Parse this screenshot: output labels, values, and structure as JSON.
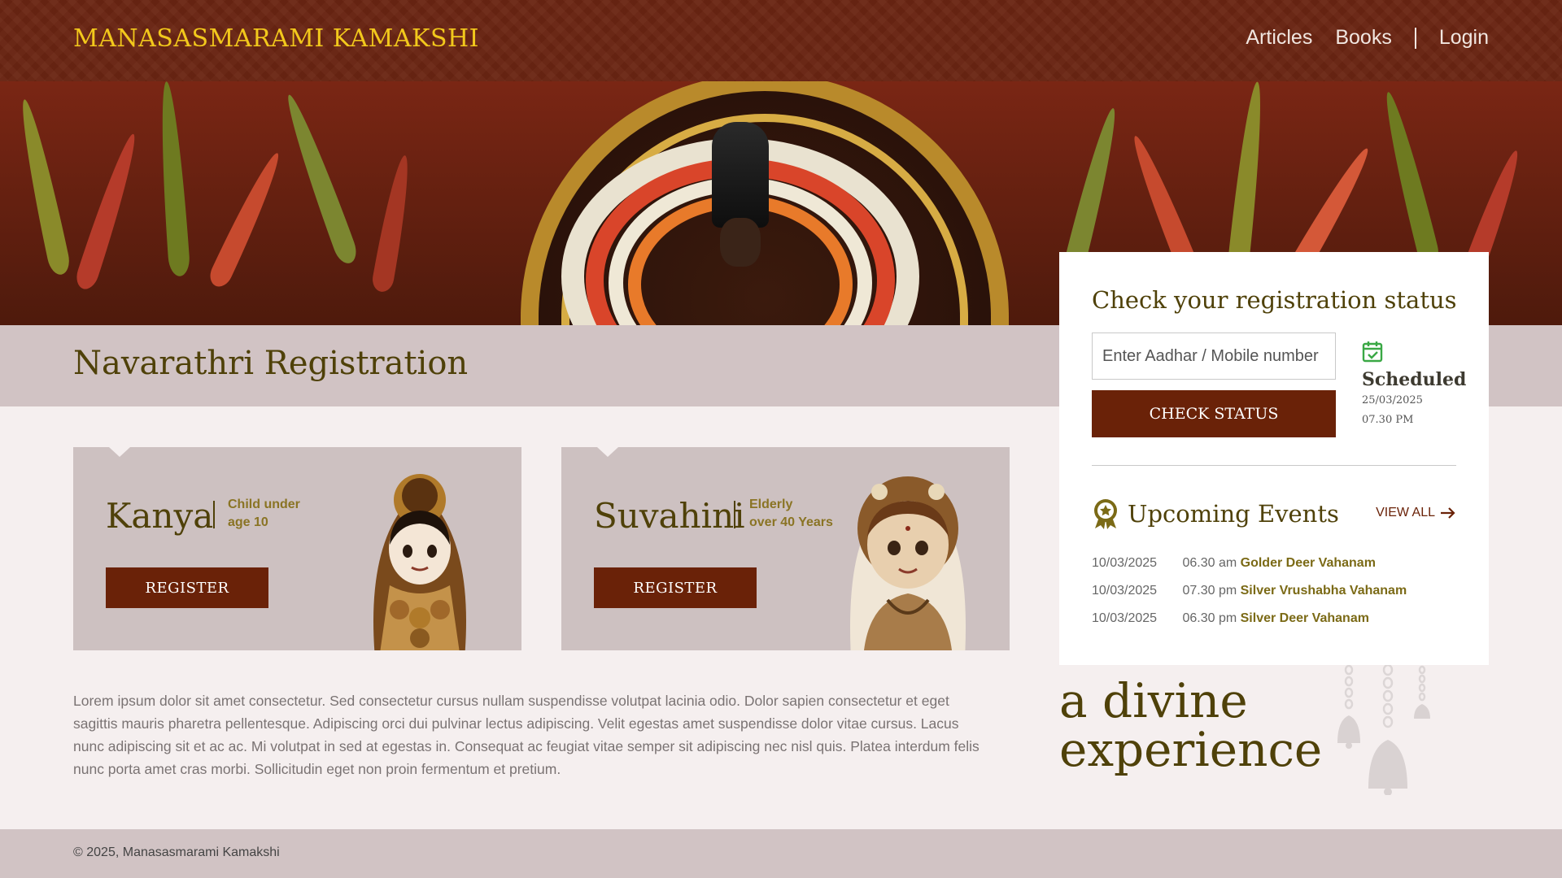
{
  "header": {
    "brand": "MANASASMARAMI KAMAKSHI",
    "nav": {
      "articles": "Articles",
      "books": "Books",
      "login": "Login"
    }
  },
  "page": {
    "title": "Navarathri Registration"
  },
  "cards": [
    {
      "title": "Kanya",
      "subtitle_line1": "Child under",
      "subtitle_line2": "age 10",
      "button": "REGISTER"
    },
    {
      "title": "Suvahini",
      "subtitle_line1": "Elderly",
      "subtitle_line2": "over 40 Years",
      "button": "REGISTER"
    }
  ],
  "description": "Lorem ipsum dolor sit amet consectetur. Sed consectetur cursus nullam suspendisse volutpat lacinia odio. Dolor sapien consectetur et eget sagittis mauris pharetra pellentesque. Adipiscing orci dui pulvinar lectus adipiscing. Velit egestas amet suspendisse dolor vitae cursus. Lacus nunc adipiscing sit et ac ac. Mi volutpat in sed at egestas in. Consequat ac feugiat vitae semper sit adipiscing nec nisl quis. Platea interdum felis nunc porta amet cras morbi. Sollicitudin eget non proin fermentum et pretium.",
  "status_panel": {
    "title": "Check your registration status",
    "input_placeholder": "Enter Aadhar / Mobile number",
    "button": "CHECK STATUS",
    "status_label": "Scheduled",
    "status_date": "25/03/2025",
    "status_time": "07.30 PM",
    "status_icon": "calendar-check-icon",
    "status_color": "#3aa845"
  },
  "events": {
    "title": "Upcoming Events",
    "view_all": "VIEW ALL",
    "items": [
      {
        "date": "10/03/2025",
        "time": "06.30 am",
        "name": "Golder Deer Vahanam"
      },
      {
        "date": "10/03/2025",
        "time": "07.30 pm",
        "name": "Silver Vrushabha Vahanam"
      },
      {
        "date": "10/03/2025",
        "time": "06.30 pm",
        "name": "Silver Deer Vahanam"
      }
    ]
  },
  "tagline": {
    "line1": "a divine",
    "line2": "experience"
  },
  "footer": {
    "copyright": "2025, Manasasmarami Kamakshi"
  },
  "colors": {
    "brand_maroon": "#6a2208",
    "brand_gold": "#f2c81c",
    "heading_olive": "#4f4109",
    "band": "#d1c3c4"
  }
}
